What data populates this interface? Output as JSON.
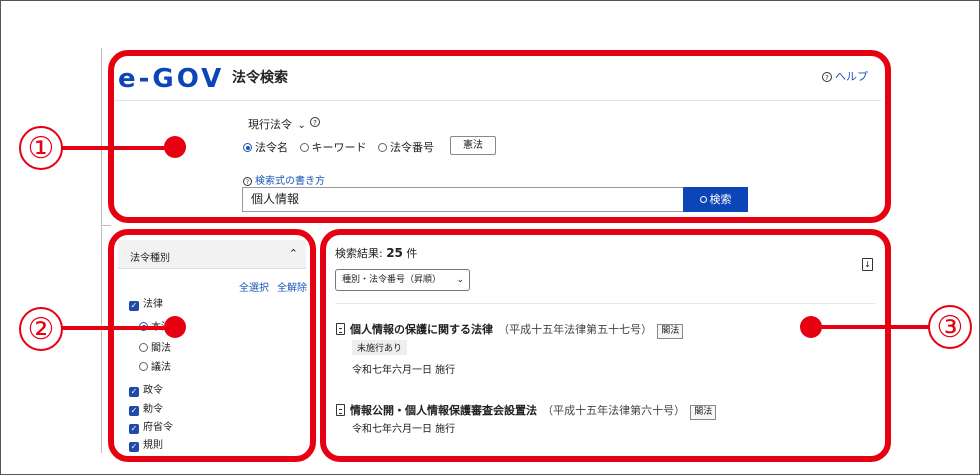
{
  "header": {
    "logo_text": "e-GOV",
    "title": "法令検索",
    "help_label": "ヘルプ"
  },
  "search": {
    "scope_label": "現行法令",
    "scope_chevron": "⌄",
    "modes": [
      "法令名",
      "キーワード",
      "法令番号"
    ],
    "selected_mode": "法令名",
    "constitution_button": "憲法",
    "syntax_help_link": "検索式の書き方",
    "query_value": "個人情報",
    "search_button": "検索"
  },
  "sidebar": {
    "section_title": "法令種別",
    "select_all": "全選択",
    "clear_all": "全解除",
    "law_label": "法律",
    "law_subitems": [
      "本法",
      "閣法",
      "議法"
    ],
    "other_types": [
      "政令",
      "勅令",
      "府省令",
      "規則"
    ]
  },
  "results": {
    "count_prefix": "検索結果: ",
    "count_value": "25",
    "count_suffix": " 件",
    "sort_value": "種別・法令番号（昇順）",
    "items": [
      {
        "title": "個人情報の保護に関する法律",
        "number": "（平成十五年法律第五十七号）",
        "tag": "閣法",
        "status": "未施行あり",
        "effective": "令和七年六月一日 施行"
      },
      {
        "title": "情報公開・個人情報保護審査会設置法",
        "number": "（平成十五年法律第六十号）",
        "tag": "閣法",
        "status": "",
        "effective": "令和七年六月一日 施行"
      }
    ]
  },
  "callouts": [
    "①",
    "②",
    "③"
  ],
  "colors": {
    "accent_red": "#e60012",
    "brand_blue": "#0b45b8",
    "link_blue": "#1a56b8"
  }
}
